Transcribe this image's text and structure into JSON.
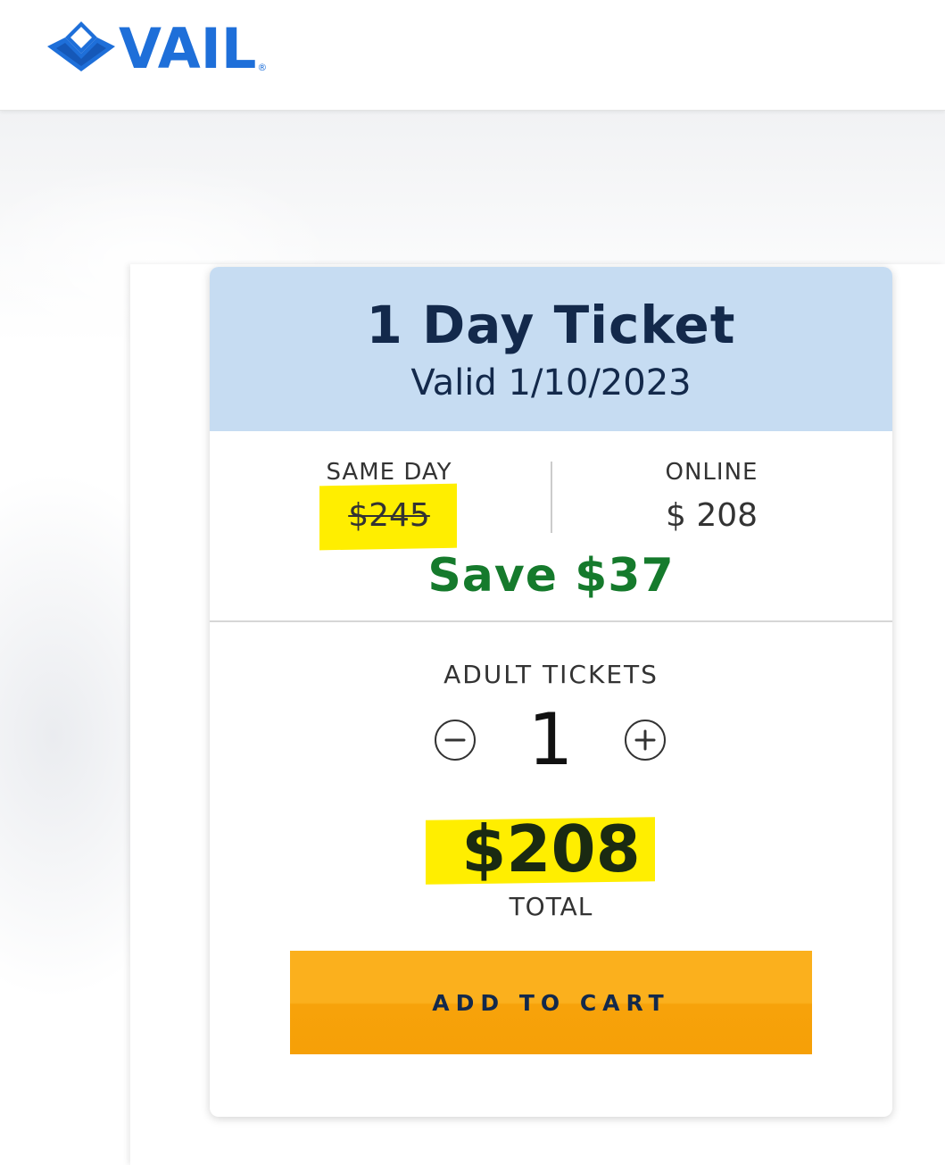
{
  "header": {
    "logo_text": "VAIL",
    "logo_reg": "®",
    "brand_color": "#1e6fd9"
  },
  "ticket": {
    "title": "1 Day Ticket",
    "valid": "Valid 1/10/2023",
    "same_day_label": "SAME DAY",
    "same_day_price": "$245",
    "online_label": "ONLINE",
    "online_price": "$ 208",
    "save": "Save $37",
    "adult_label": "ADULT TICKETS",
    "quantity": "1",
    "total_amount": "$208",
    "total_label": "TOTAL",
    "add_to_cart": "ADD TO CART"
  },
  "icons": {
    "logo": "vail-mountain-logo-icon",
    "decrement": "minus-circle-icon",
    "increment": "plus-circle-icon"
  },
  "colors": {
    "header_band": "#c6dcf2",
    "title_text": "#13294b",
    "save_text": "#157a2c",
    "highlight": "#ffee00",
    "cart_button": "#fbb01d"
  }
}
